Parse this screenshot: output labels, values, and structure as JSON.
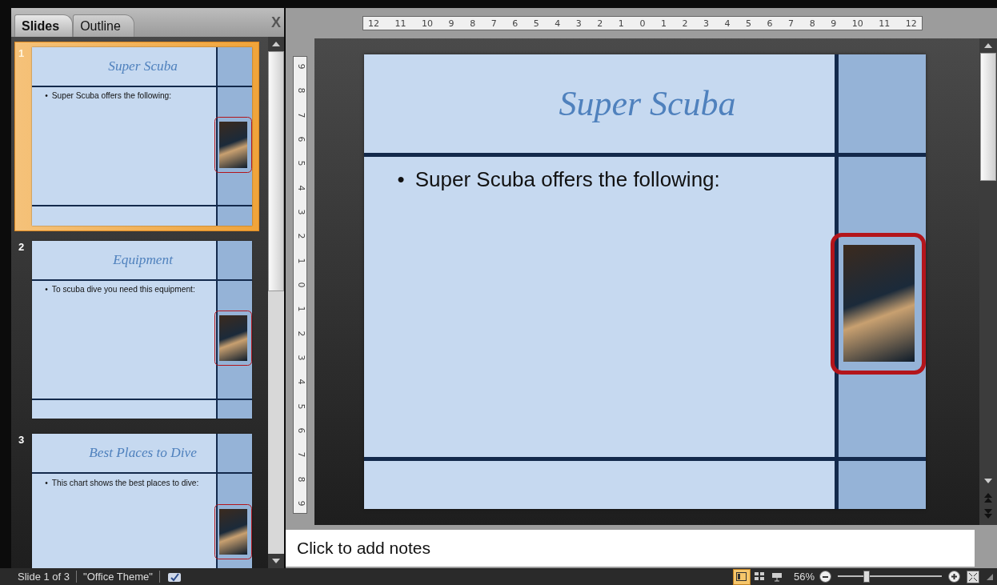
{
  "panel": {
    "tabs": [
      {
        "label": "Slides",
        "selected": true
      },
      {
        "label": "Outline",
        "selected": false
      }
    ],
    "close": "X"
  },
  "slides": [
    {
      "number": "1",
      "title": "Super Scuba",
      "marker": "•",
      "bullet": "Super Scuba offers the following:",
      "selected": true,
      "highlighted": true
    },
    {
      "number": "2",
      "title": "Equipment",
      "marker": "•",
      "bullet": "To scuba dive you need this equipment:",
      "selected": false,
      "highlighted": true
    },
    {
      "number": "3",
      "title": "Best Places to Dive",
      "marker": "•",
      "bullet": "This chart shows the best places to dive:",
      "selected": false,
      "highlighted": true
    }
  ],
  "ruler": {
    "horizontal": [
      "12",
      "11",
      "10",
      "9",
      "8",
      "7",
      "6",
      "5",
      "4",
      "3",
      "2",
      "1",
      "0",
      "1",
      "2",
      "3",
      "4",
      "5",
      "6",
      "7",
      "8",
      "9",
      "10",
      "11",
      "12"
    ],
    "vertical": [
      "9",
      "8",
      "7",
      "6",
      "5",
      "4",
      "3",
      "2",
      "1",
      "0",
      "1",
      "2",
      "3",
      "4",
      "5",
      "6",
      "7",
      "8",
      "9"
    ]
  },
  "current_slide": {
    "title": "Super Scuba",
    "marker": "•",
    "bullet": "Super Scuba offers the following:",
    "highlighted": true
  },
  "notes": {
    "placeholder": "Click to add notes"
  },
  "status_bar": {
    "slide_info": "Slide 1 of 3",
    "theme": "\"Office Theme\"",
    "views": [
      {
        "kind": "normal",
        "selected": true
      },
      {
        "kind": "sorter",
        "selected": false
      },
      {
        "kind": "show",
        "selected": false
      }
    ],
    "zoom": "56%",
    "zoom_slider": {
      "level": 0.28
    }
  }
}
